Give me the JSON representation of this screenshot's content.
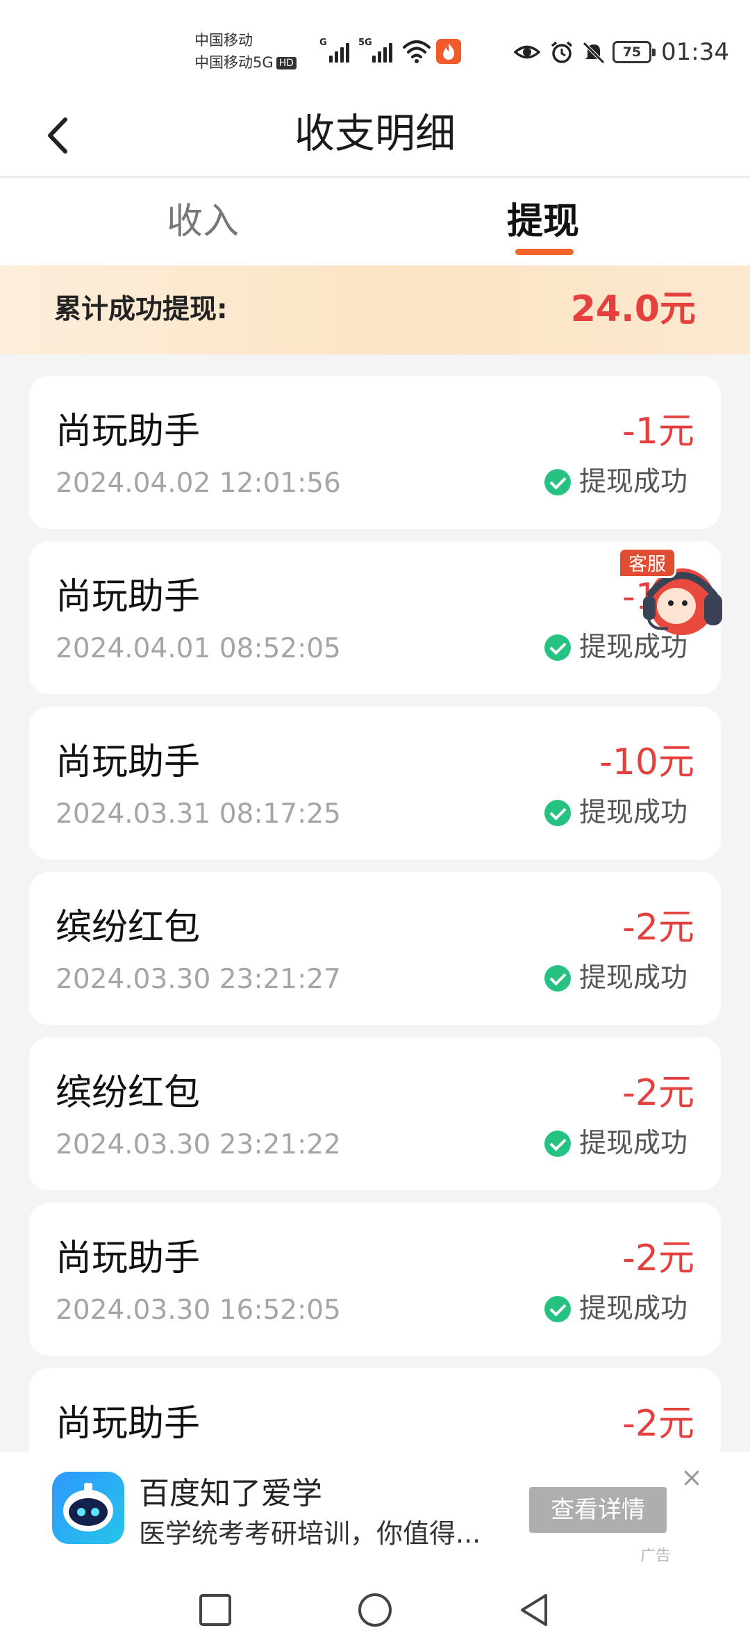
{
  "status_bar": {
    "carrier_1": "中国移动",
    "carrier_2": "中国移动5G",
    "hd_badge": "HD",
    "sim1_network": "G",
    "sim2_network": "5G",
    "battery": "75",
    "time": "01:34",
    "icons": [
      "signal-icon",
      "wifi-icon",
      "hotspot-fire-icon",
      "eye-icon",
      "alarm-icon",
      "mute-icon",
      "battery-icon"
    ]
  },
  "header": {
    "title": "收支明细",
    "back_icon": "chevron-left-icon"
  },
  "tabs": [
    {
      "label": "收入",
      "active": false
    },
    {
      "label": "提现",
      "active": true
    }
  ],
  "summary": {
    "label": "累计成功提现:",
    "value": "24.0元"
  },
  "records": [
    {
      "name": "尚玩助手",
      "time": "2024.04.02 12:01:56",
      "amount": "-1元",
      "status": "提现成功"
    },
    {
      "name": "尚玩助手",
      "time": "2024.04.01 08:52:05",
      "amount": "-1元",
      "status": "提现成功"
    },
    {
      "name": "尚玩助手",
      "time": "2024.03.31 08:17:25",
      "amount": "-10元",
      "status": "提现成功"
    },
    {
      "name": "缤纷红包",
      "time": "2024.03.30 23:21:27",
      "amount": "-2元",
      "status": "提现成功"
    },
    {
      "name": "缤纷红包",
      "time": "2024.03.30 23:21:22",
      "amount": "-2元",
      "status": "提现成功"
    },
    {
      "name": "尚玩助手",
      "time": "2024.03.30 16:52:05",
      "amount": "-2元",
      "status": "提现成功"
    },
    {
      "name": "尚玩助手",
      "time": "",
      "amount": "-2元",
      "status": ""
    }
  ],
  "customer_service": {
    "tag": "客服"
  },
  "ad": {
    "title": "百度知了爱学",
    "description": "医学统考考研培训，你值得...",
    "button": "查看详情",
    "close": "×",
    "tag": "广告"
  },
  "colors": {
    "accent": "#f2632a",
    "amount_red": "#e3403e",
    "success_green": "#26c281"
  }
}
